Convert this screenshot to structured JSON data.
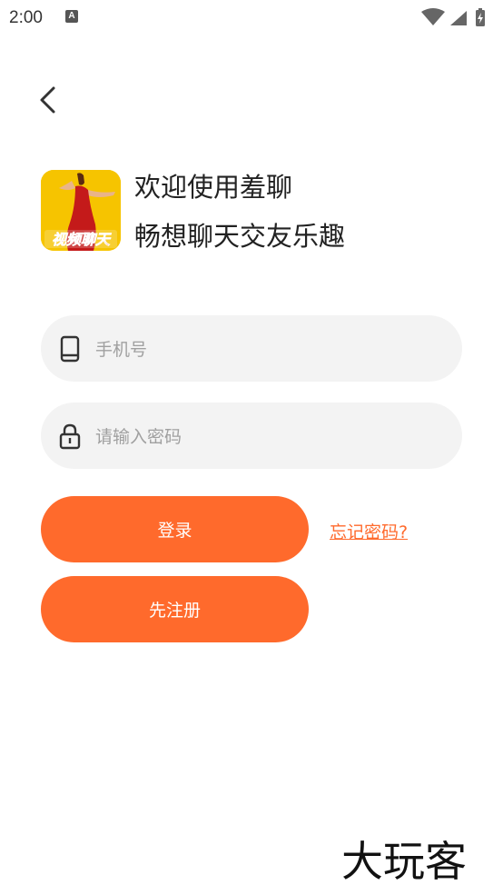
{
  "status_bar": {
    "time": "2:00",
    "notification_letter": "A"
  },
  "header": {
    "welcome": "欢迎使用羞聊",
    "slogan": "畅想聊天交友乐趣"
  },
  "logo": {
    "text": "视频聊天"
  },
  "form": {
    "phone_placeholder": "手机号",
    "password_placeholder": "请输入密码"
  },
  "buttons": {
    "login": "登录",
    "register": "先注册",
    "forgot": "忘记密码?"
  },
  "watermark": {
    "text": "大玩客"
  },
  "colors": {
    "accent": "#ff6a2c",
    "field_bg": "#f3f3f3",
    "logo_bg": "#f6c400"
  }
}
